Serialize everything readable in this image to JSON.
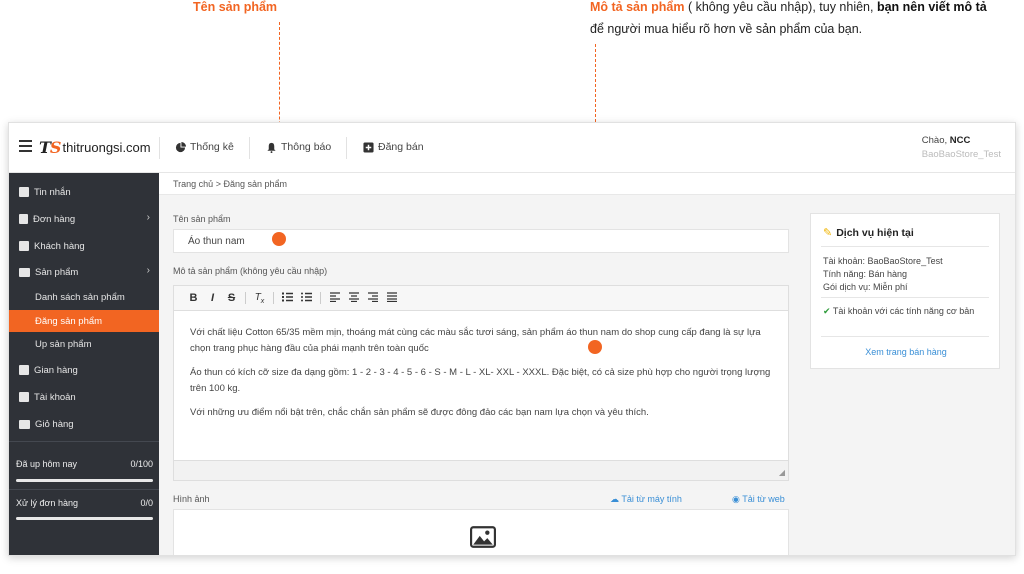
{
  "callouts": {
    "name_title": "Tên sản phẩm",
    "desc_title": "Mô tả sản phẩm",
    "desc_text_1": " ( không yêu cầu nhập), tuy nhiên, ",
    "desc_text_bold": "bạn nên viết mô tả",
    "desc_text_2": "để người mua hiểu rõ hơn về sản phẩm của bạn.",
    "accent": "#f26522"
  },
  "header": {
    "logo_mark": "TS",
    "logo_text": "thitruongsi.com",
    "nav": [
      {
        "label": "Thống kê",
        "icon": "pie-chart-icon"
      },
      {
        "label": "Thông báo",
        "icon": "bell-icon"
      },
      {
        "label": "Đăng bán",
        "icon": "plus-square-icon"
      }
    ],
    "greeting_prefix": "Chào, ",
    "greeting_name": "NCC",
    "store_name": "BaoBaoStore_Test"
  },
  "sidebar": {
    "items": [
      {
        "label": "Tin nhắn",
        "icon": "chat-icon"
      },
      {
        "label": "Đơn hàng",
        "icon": "file-icon",
        "chevron": "›"
      },
      {
        "label": "Khách hàng",
        "icon": "contact-icon"
      },
      {
        "label": "Sản phẩm",
        "icon": "box-icon",
        "chevron": "›"
      },
      {
        "label": "Gian hàng",
        "icon": "store-icon"
      },
      {
        "label": "Tài khoản",
        "icon": "user-icon"
      },
      {
        "label": "Giỏ hàng",
        "icon": "cart-icon"
      }
    ],
    "sub_items": [
      {
        "label": "Danh sách sản phẩm",
        "active": false
      },
      {
        "label": "Đăng sản phẩm",
        "active": true
      },
      {
        "label": "Up sản phẩm",
        "active": false
      }
    ],
    "stats": [
      {
        "label": "Đã up hôm nay",
        "value": "0/100"
      },
      {
        "label": "Xử lý đơn hàng",
        "value": "0/0"
      }
    ]
  },
  "main": {
    "breadcrumb": "Trang chủ > Đăng sản phẩm",
    "name_label": "Tên sản phẩm",
    "name_value": "Áo thun nam",
    "desc_label": "Mô tả sản phẩm (không yêu cầu nhập)",
    "toolbar": [
      "B",
      "I",
      "S",
      "Tx",
      "ordered-list",
      "bullet-list",
      "align-left",
      "align-center",
      "align-right",
      "align-justify"
    ],
    "paragraphs": [
      "Với chất liệu Cotton 65/35 mềm mịn, thoáng mát cùng các màu sắc tươi sáng, sản phẩm áo thun nam do shop cung cấp đang là sự lựa chọn trang phục hàng đầu của phái mạnh trên toàn quốc",
      "Áo thun có kích cỡ size đa dạng gồm: 1 - 2 - 3 - 4 - 5 - 6 - S - M - L - XL- XXL - XXXL. Đặc biệt, có cả size phù hợp cho người trọng lượng trên 100 kg.",
      "Với những ưu điểm nổi bật trên, chắc chắn sản phẩm sẽ được đông đảo các bạn nam lựa chọn và yêu thích."
    ],
    "image_label": "Hình ảnh",
    "upload_computer": "Tải từ máy tính",
    "upload_web": "Tải từ web"
  },
  "service": {
    "title": "Dịch vụ hiện tại",
    "account": "Tài khoản: BaoBaoStore_Test",
    "feature": "Tính năng: Bán hàng",
    "package": "Gói dịch vụ: Miễn phí",
    "check_text": "Tài khoản với các tính năng cơ bản",
    "link": "Xem trang bán hàng"
  }
}
